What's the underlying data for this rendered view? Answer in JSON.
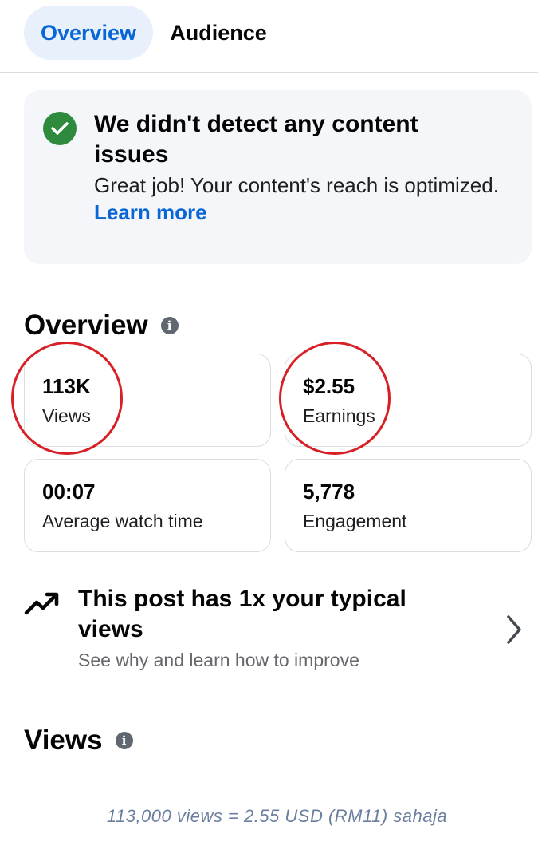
{
  "tabs": [
    {
      "label": "Overview",
      "active": true
    },
    {
      "label": "Audience",
      "active": false
    }
  ],
  "banner": {
    "icon": "check-circle-icon",
    "title": "We didn't detect any content issues",
    "body": "Great job! Your content's reach is optimized.",
    "link": "Learn more"
  },
  "overview": {
    "title": "Overview",
    "info_icon": "i",
    "metrics": [
      {
        "value": "113K",
        "label": "Views",
        "highlighted": true
      },
      {
        "value": "$2.55",
        "label": "Earnings",
        "highlighted": true
      },
      {
        "value": "00:07",
        "label": "Average watch time",
        "highlighted": false
      },
      {
        "value": "5,778",
        "label": "Engagement",
        "highlighted": false
      }
    ]
  },
  "insight": {
    "icon": "trending-up-icon",
    "title": "This post has 1x your typical views",
    "subtitle": "See why and learn how to improve"
  },
  "views_section": {
    "title": "Views",
    "info_icon": "i"
  },
  "caption": "113,000 views = 2.55 USD (RM11) sahaja",
  "colors": {
    "accent": "#0866d6",
    "tab_active_bg": "#e7f0fb",
    "success": "#2e8a3c",
    "annotation_circle": "#d71f25",
    "caption": "#6a7e9d"
  }
}
